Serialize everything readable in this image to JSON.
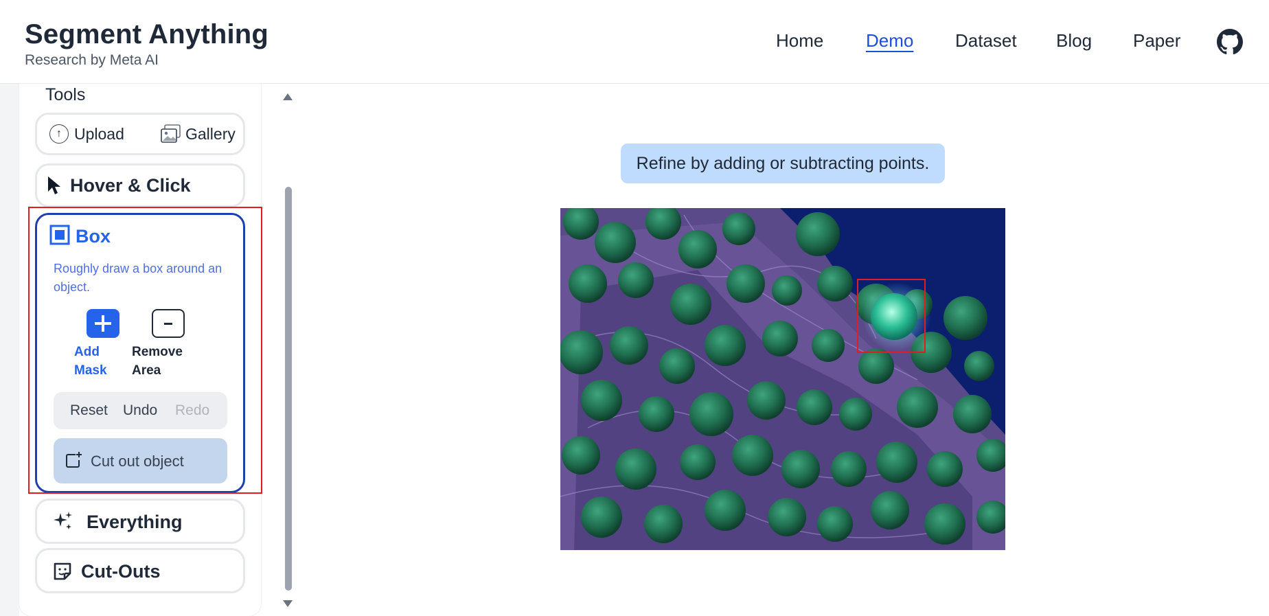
{
  "header": {
    "title": "Segment Anything",
    "subtitle": "Research by Meta AI",
    "nav": [
      "Home",
      "Demo",
      "Dataset",
      "Blog",
      "Paper"
    ],
    "active_nav": "Demo",
    "github_icon": "github-icon"
  },
  "sidebar": {
    "tools_label": "Tools",
    "upload_label": "Upload",
    "gallery_label": "Gallery",
    "hover_click_label": "Hover & Click",
    "box": {
      "title": "Box",
      "description": "Roughly draw a box around an object.",
      "add_label_1": "Add",
      "add_label_2": "Mask",
      "remove_label_1": "Remove",
      "remove_label_2": "Area",
      "reset_label": "Reset",
      "undo_label": "Undo",
      "redo_label": "Redo",
      "cutout_label": "Cut out object"
    },
    "everything_label": "Everything",
    "cutouts_label": "Cut-Outs"
  },
  "main": {
    "hint": "Refine by adding or subtracting points."
  },
  "colors": {
    "accent": "#2563eb",
    "selection": "#e11d24",
    "hint_bg": "#bfdbfe"
  }
}
